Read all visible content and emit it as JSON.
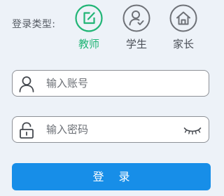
{
  "login_type": {
    "label": "登录类型:",
    "roles": [
      {
        "id": "teacher",
        "label": "教师",
        "selected": true,
        "color": "#21b576"
      },
      {
        "id": "student",
        "label": "学生",
        "selected": false
      },
      {
        "id": "parent",
        "label": "家长",
        "selected": false
      }
    ]
  },
  "account": {
    "placeholder": "输入账号",
    "icon": "user-icon"
  },
  "password": {
    "placeholder": "输入密码",
    "icon": "lock-icon",
    "toggle_icon": "eye-closed-icon"
  },
  "login_button": {
    "label": "登 录",
    "color": "#178ee8"
  }
}
